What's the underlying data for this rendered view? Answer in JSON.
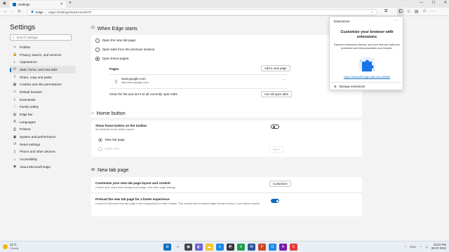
{
  "window": {
    "tab_title": "Settings",
    "tab_close": "✕",
    "new_tab": "+",
    "controls": [
      "—",
      "☐",
      "✕"
    ]
  },
  "address_bar": {
    "site_label": "Edge",
    "separator": "|",
    "url": "edge://settings/startHomeNTP"
  },
  "sidebar": {
    "title": "Settings",
    "search_placeholder": "Search settings",
    "items": [
      {
        "label": "Profiles",
        "icon": "profile-icon"
      },
      {
        "label": "Privacy, search, and services",
        "icon": "lock-icon"
      },
      {
        "label": "Appearance",
        "icon": "appearance-icon"
      },
      {
        "label": "Start, home, and new tabs",
        "icon": "power-icon",
        "active": true
      },
      {
        "label": "Share, copy and paste",
        "icon": "share-icon"
      },
      {
        "label": "Cookies and site permissions",
        "icon": "cookie-icon"
      },
      {
        "label": "Default browser",
        "icon": "browser-icon"
      },
      {
        "label": "Downloads",
        "icon": "download-icon"
      },
      {
        "label": "Family safety",
        "icon": "family-icon"
      },
      {
        "label": "Edge bar",
        "icon": "edgebar-icon"
      },
      {
        "label": "Languages",
        "icon": "language-icon"
      },
      {
        "label": "Printers",
        "icon": "printer-icon"
      },
      {
        "label": "System and performance",
        "icon": "system-icon"
      },
      {
        "label": "Reset settings",
        "icon": "reset-icon"
      },
      {
        "label": "Phone and other devices",
        "icon": "phone-icon"
      },
      {
        "label": "Accessibility",
        "icon": "accessibility-icon"
      },
      {
        "label": "About Microsoft Edge",
        "icon": "edge-icon"
      }
    ]
  },
  "when_edge_starts": {
    "heading": "When Edge starts",
    "options": [
      "Open the new tab page",
      "Open tabs from the previous session",
      "Open these pages:"
    ],
    "selected_index": 2,
    "pages_label": "Pages",
    "add_page_button": "Add a new page",
    "page": {
      "title": "www.google.com",
      "url": "http://www.google.com/"
    },
    "clear_text": "Clear the list and set it to all currently open tabs",
    "use_open_tabs_button": "Use all open tabs"
  },
  "home_button": {
    "heading": "Home button",
    "show_label": "Show home button on the toolbar",
    "show_desc": "Set what the home button opens",
    "show_on": false,
    "options": [
      "New tab page",
      "Enter URL"
    ],
    "save_button": "Save"
  },
  "new_tab_page": {
    "heading": "New tab page",
    "customize_label": "Customize your new tab page layout and content",
    "customize_desc": "Control your news feed, background image, and other page settings",
    "customize_button": "Customize",
    "preload_label": "Preload the new tab page for a faster experience",
    "preload_desc": "Loads the Microsoft new tab page in the background to make it faster. The content that is loaded might include cookies, if you allow cookies.",
    "preload_on": true
  },
  "extensions_panel": {
    "title": "Extensions",
    "more": "···",
    "heading": "Customize your browser with extensions",
    "description": "Discover extensions, themes, and more that can make you productive and help personalize your browser.",
    "link": "Open Microsoft Edge Add-ons website",
    "manage": "Manage extensions"
  },
  "taskbar": {
    "weather_temp": "31°C",
    "weather_desc": "Cloudy",
    "lang": "ENG",
    "time": "03:22 PM",
    "date": "30-07-2022"
  },
  "colors": {
    "accent": "#0f6cbd"
  }
}
